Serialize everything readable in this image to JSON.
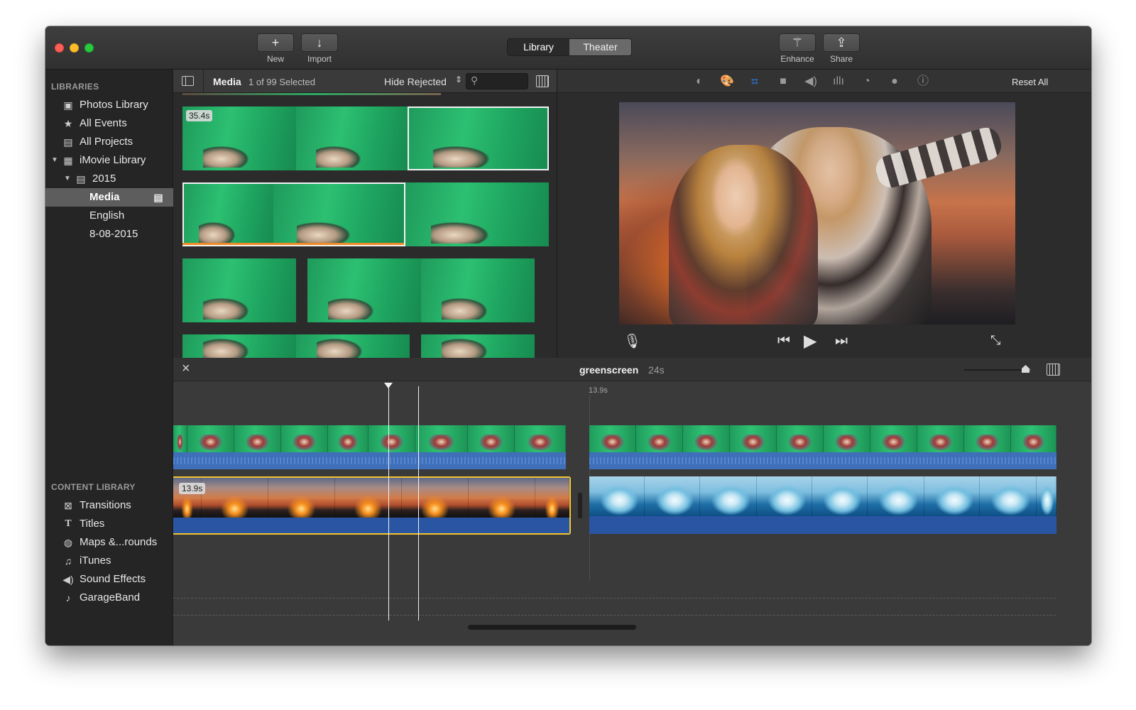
{
  "toolbar": {
    "new_label": "New",
    "import_label": "Import",
    "enhance_label": "Enhance",
    "share_label": "Share",
    "segment": {
      "library": "Library",
      "theater": "Theater",
      "selected": "Library"
    }
  },
  "sidebar": {
    "libraries_header": "LIBRARIES",
    "libraries": [
      {
        "label": "Photos Library",
        "icon": "photos-icon"
      },
      {
        "label": "All Events",
        "icon": "star-icon"
      },
      {
        "label": "All Projects",
        "icon": "clapper-icon"
      },
      {
        "label": "iMovie Library",
        "icon": "grid-icon"
      },
      {
        "label": "2015",
        "icon": "calendar-icon"
      },
      {
        "label": "Media",
        "icon": "clapper-icon",
        "selected": true
      },
      {
        "label": "English"
      },
      {
        "label": "8-08-2015"
      }
    ],
    "content_header": "CONTENT LIBRARY",
    "content": [
      {
        "label": "Transitions",
        "icon": "transitions-icon"
      },
      {
        "label": "Titles",
        "icon": "titles-icon"
      },
      {
        "label": "Maps &...rounds",
        "icon": "globe-icon"
      },
      {
        "label": "iTunes",
        "icon": "music-icon"
      },
      {
        "label": "Sound Effects",
        "icon": "speaker-icon"
      },
      {
        "label": "GarageBand",
        "icon": "guitar-icon"
      }
    ]
  },
  "browser": {
    "title": "Media",
    "selection_count": "1 of 99 Selected",
    "filter": "Hide Rejected",
    "search_placeholder": "",
    "first_clip_duration": "35.4s"
  },
  "viewer": {
    "reset_all": "Reset All"
  },
  "timeline": {
    "project_name": "greenscreen",
    "project_duration": "24s",
    "marker_time": "13.9s",
    "clip_duration": "13.9s",
    "zoom_level": 0.92
  },
  "colors": {
    "accent_blue": "#2a7be0",
    "selection_yellow": "#f4c430",
    "audio_blue": "#3f6fb9"
  }
}
